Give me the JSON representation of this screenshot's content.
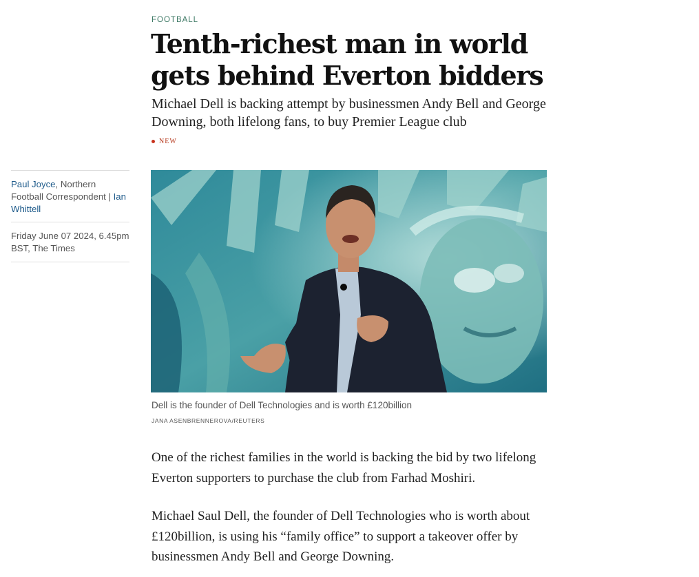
{
  "article": {
    "section": "FOOTBALL",
    "headline": "Tenth-richest man in world gets behind Everton bidders",
    "standfirst": "Michael Dell is backing attempt by businessmen Andy Bell and George Downing, both lifelong fans, to buy Premier League club",
    "badge": "NEW",
    "byline": {
      "author1": "Paul Joyce",
      "author1_role": ", Northern Football Correspondent | ",
      "author2": "Ian Whittell",
      "date": "Friday June 07 2024, 6.45pm BST, The Times"
    },
    "image": {
      "caption": "Dell is the founder of Dell Technologies and is worth £120billion",
      "credit": "JANA ASENBRENNEROVA/REUTERS"
    },
    "paragraphs": [
      "One of the richest families in the world is backing the bid by two lifelong Everton supporters to purchase the club from Farhad Moshiri.",
      "Michael Saul Dell, the founder of Dell Technologies who is worth about £120billion, is using his “family office” to support a takeover offer by businessmen Andy Bell and George Downing."
    ]
  },
  "colors": {
    "section": "#3f7a66",
    "author_link": "#1d5a8a",
    "badge": "#b5361a"
  }
}
